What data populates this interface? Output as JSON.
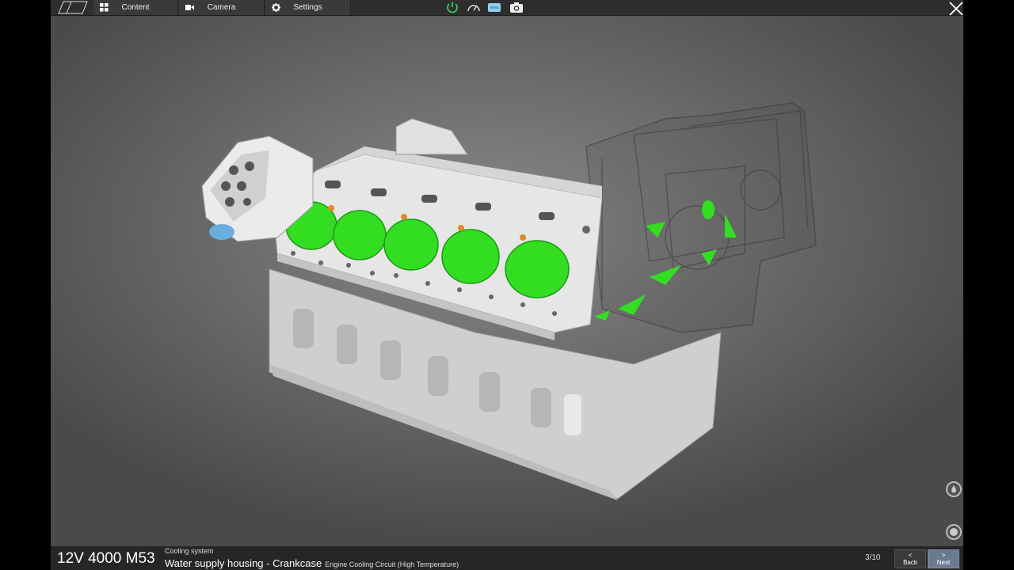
{
  "menu": {
    "content_label": "Content",
    "camera_label": "Camera",
    "settings_label": "Settings"
  },
  "footer": {
    "engine_name": "12V 4000 M53",
    "category": "Cooling system",
    "step_title": "Water supply housing - Crankcase",
    "step_subtitle": "Engine Cooling Circuit (High Temperature)",
    "page_counter": "3/10",
    "back_label": "Back",
    "next_label": "Next",
    "back_arrow": "<",
    "next_arrow": ">"
  },
  "colors": {
    "highlight": "#33dd22",
    "accent_blue": "#8fd0f0",
    "power_green": "#3ec95a"
  }
}
